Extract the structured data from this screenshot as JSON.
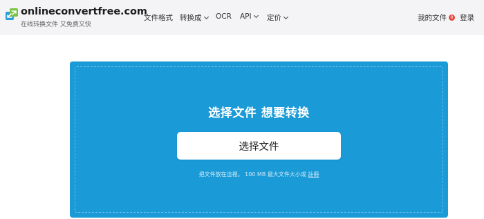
{
  "header": {
    "logo_name": "onlineconvertfree.com",
    "logo_tagline": "在线转换文件 又免费又快",
    "nav": [
      {
        "label": "文件格式",
        "dropdown": false
      },
      {
        "label": "转换成",
        "dropdown": true
      },
      {
        "label": "OCR",
        "dropdown": false
      },
      {
        "label": "API",
        "dropdown": true
      },
      {
        "label": "定价",
        "dropdown": true
      }
    ],
    "my_files_label": "我的文件",
    "my_files_count": "0",
    "login_label": "登录"
  },
  "upload": {
    "title": "选择文件 想要转换",
    "choose_button": "选择文件",
    "hint_text": "把文件放在這裡。 100 MB 最大文件大小或",
    "hint_link": "註冊"
  },
  "colors": {
    "panel_blue": "#1a9ad7",
    "header_bg": "#f4f4f6",
    "badge_red": "#e8443a",
    "logo_green": "#7cc242",
    "logo_blue": "#2a9fd8"
  }
}
